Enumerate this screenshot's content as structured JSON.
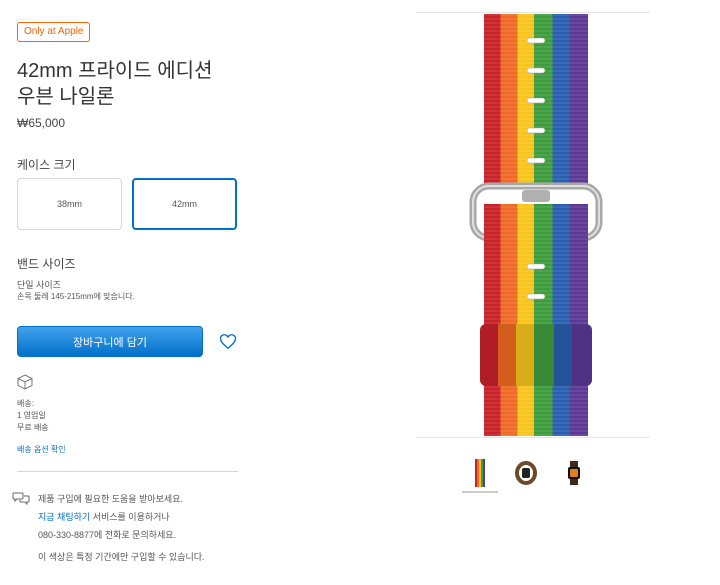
{
  "product": {
    "badge": "Only at Apple",
    "title_line1": "42mm 프라이드 에디션",
    "title_line2": "우븐 나일론",
    "price": "₩65,000"
  },
  "case_size": {
    "label": "케이스 크기",
    "options": [
      "38mm",
      "42mm"
    ],
    "selected": "42mm"
  },
  "band_size": {
    "label": "밴드 사이즈",
    "value": "단일 사이즈",
    "note": "손목 둘레 145-215mm에 맞습니다."
  },
  "cart": {
    "add_label": "장바구니에 담기"
  },
  "shipping": {
    "label": "배송:",
    "eta": "1 영업일",
    "cost": "무료 배송",
    "link": "배송 옵션 확인"
  },
  "help": {
    "line1": "제품 구입에 필요한 도움을 받아보세요.",
    "chat_link": "지금 채팅하기",
    "line2_rest": " 서비스를 이용하거나",
    "line3": "080-330-8877에 전화로 문의하세요.",
    "line4": "이 색상은 특정 기간에만 구입할 수 있습니다."
  },
  "colors": {
    "accent": "#0070c9",
    "badge": "#f56300",
    "rainbow": [
      "#c9222a",
      "#ef6a24",
      "#f7c51c",
      "#3f9c3d",
      "#2a5fb0",
      "#5b3a96"
    ]
  }
}
